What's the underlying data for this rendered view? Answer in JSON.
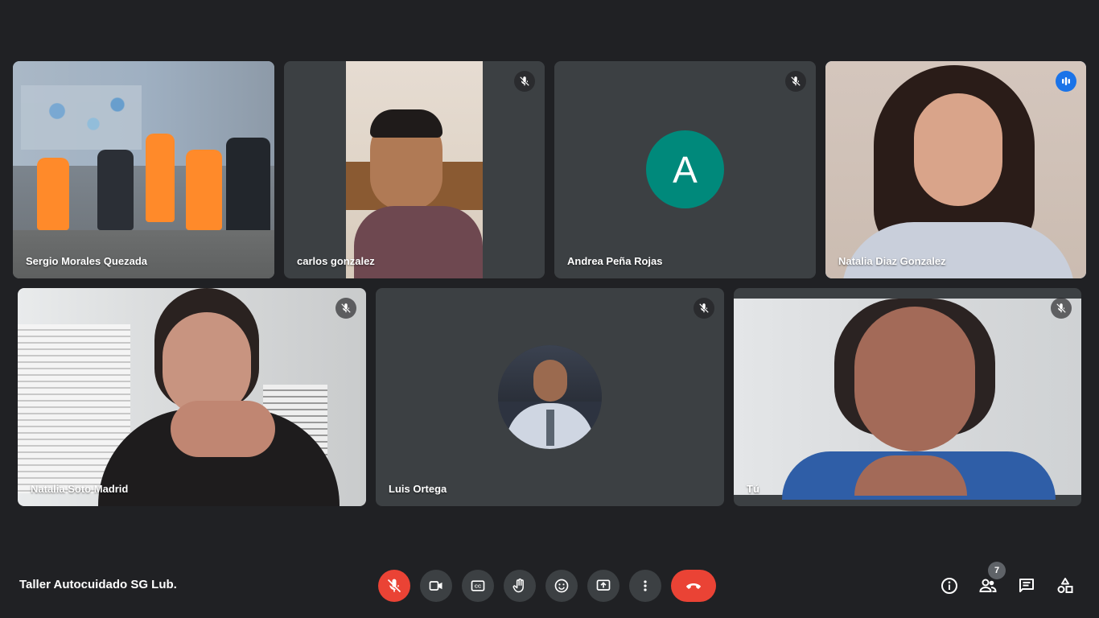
{
  "participants": [
    {
      "name": "Sergio Morales Quezada"
    },
    {
      "name": "carlos gonzalez"
    },
    {
      "name": "Andrea Peña Rojas",
      "initial": "A"
    },
    {
      "name": "Natalia Diaz Gonzalez"
    },
    {
      "name": "Natalia Soto Madrid"
    },
    {
      "name": "Luis Ortega"
    },
    {
      "name": "Tú"
    }
  ],
  "meeting": {
    "title": "Taller Autocuidado SG Lub."
  },
  "people_count": "7",
  "colors": {
    "background": "#202124",
    "tile": "#3c4043",
    "danger": "#ea4335",
    "active_border": "#8ab4f8",
    "avatar": "#00897b"
  },
  "icons": {
    "mic_off": "mic-off-icon",
    "camera": "camera-icon",
    "captions": "captions-icon",
    "raise_hand": "hand-icon",
    "emoji": "emoji-icon",
    "present": "present-icon",
    "more": "more-vert-icon",
    "end_call": "end-call-icon",
    "info": "info-icon",
    "people": "people-icon",
    "chat": "chat-icon",
    "activities": "activities-icon",
    "speaking": "speaking-indicator-icon"
  }
}
